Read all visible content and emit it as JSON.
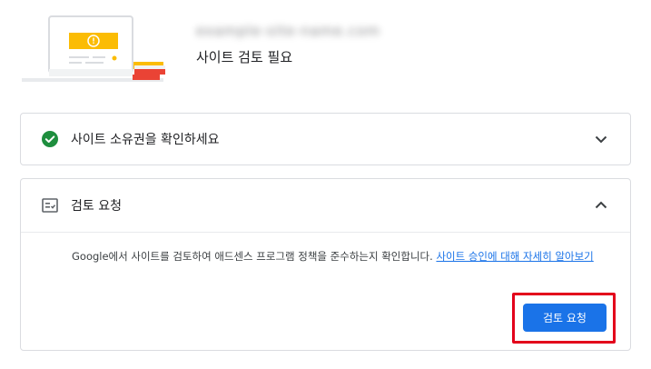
{
  "header": {
    "site_name": "example-site-name.com",
    "status": "사이트 검토 필요"
  },
  "cards": [
    {
      "title": "사이트 소유권을 확인하세요",
      "icon": "check-circle-icon",
      "status_color": "#1e8e3e",
      "expanded": false
    },
    {
      "title": "검토 요청",
      "icon": "review-checklist-icon",
      "expanded": true,
      "description": "Google에서 사이트를 검토하여 애드센스 프로그램 정책을 준수하는지 확인합니다.",
      "link_text": "사이트 승인에 대해 자세히 알아보기",
      "button_label": "검토 요청"
    }
  ],
  "colors": {
    "accent": "#1a73e8",
    "highlight": "#e3001b",
    "warning": "#fbbc04"
  }
}
